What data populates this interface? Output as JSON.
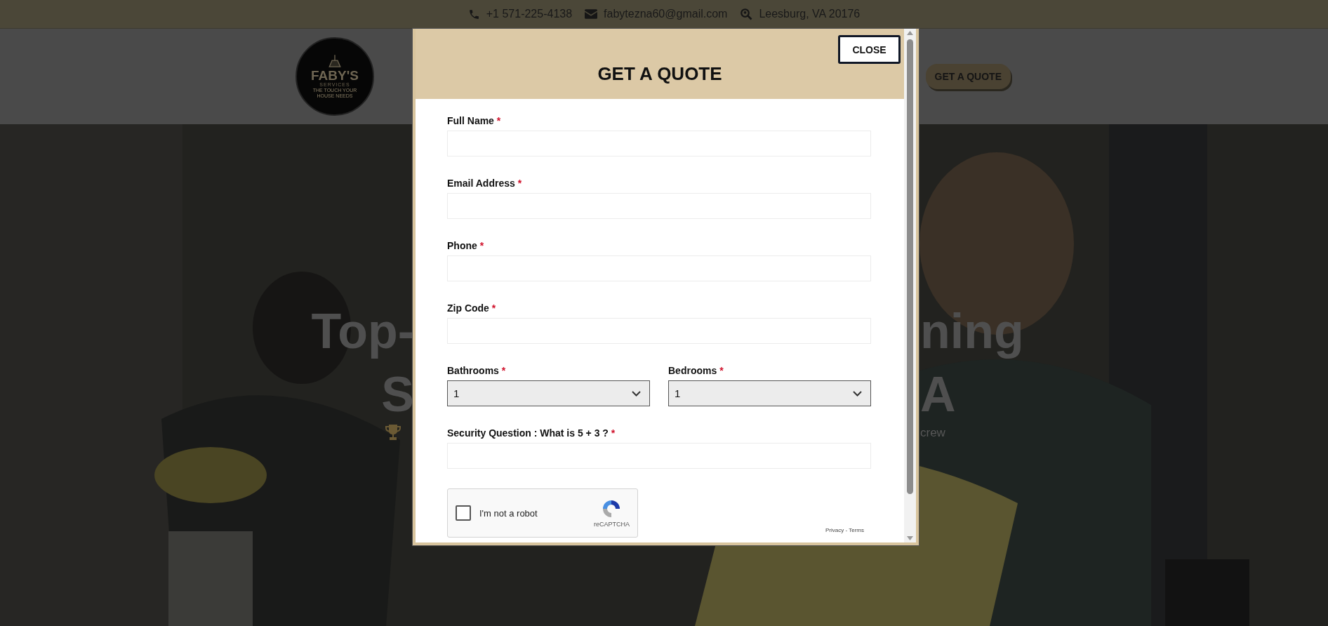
{
  "top_bar": {
    "items": [
      {
        "kind": "phone",
        "text": "+1 571-225-4138"
      },
      {
        "kind": "email",
        "text": "fabytezna60@gmail.com"
      },
      {
        "kind": "location",
        "text": "Leesburg, VA 20176"
      }
    ]
  },
  "header": {
    "logo": {
      "title": "FABY'S",
      "subtitle": "SERVICES",
      "tagline": "THE TOUCH YOUR HOUSE NEEDS"
    },
    "button": "GET A QUOTE"
  },
  "hero": {
    "heading_left": "Top-",
    "heading_right": "ning",
    "second_line_left": "S",
    "second_line_right": "A",
    "tagline_right": "crew"
  },
  "modal": {
    "title": "GET A QUOTE",
    "close": "CLOSE",
    "rows": [
      [
        {
          "label": "Full Name",
          "mark": "*",
          "kind": "text"
        }
      ],
      [
        {
          "label": "Email Address",
          "mark": "*",
          "kind": "text"
        }
      ],
      [
        {
          "label": "Phone",
          "mark": "*",
          "kind": "text"
        }
      ],
      [
        {
          "label": "Zip Code",
          "mark": "*",
          "kind": "text"
        }
      ],
      [
        {
          "label": "Bathrooms",
          "mark": "*",
          "kind": "select",
          "value": "1"
        },
        {
          "label": "Bedrooms",
          "mark": "*",
          "kind": "select",
          "value": "1"
        }
      ],
      [
        {
          "label": "Security Question : What is 5 + 3 ?",
          "mark": "*",
          "kind": "text"
        }
      ]
    ],
    "captcha": {
      "label": "I'm not a robot",
      "checked": false,
      "brand": "reCAPTCHA",
      "links": "Privacy - Terms"
    }
  }
}
